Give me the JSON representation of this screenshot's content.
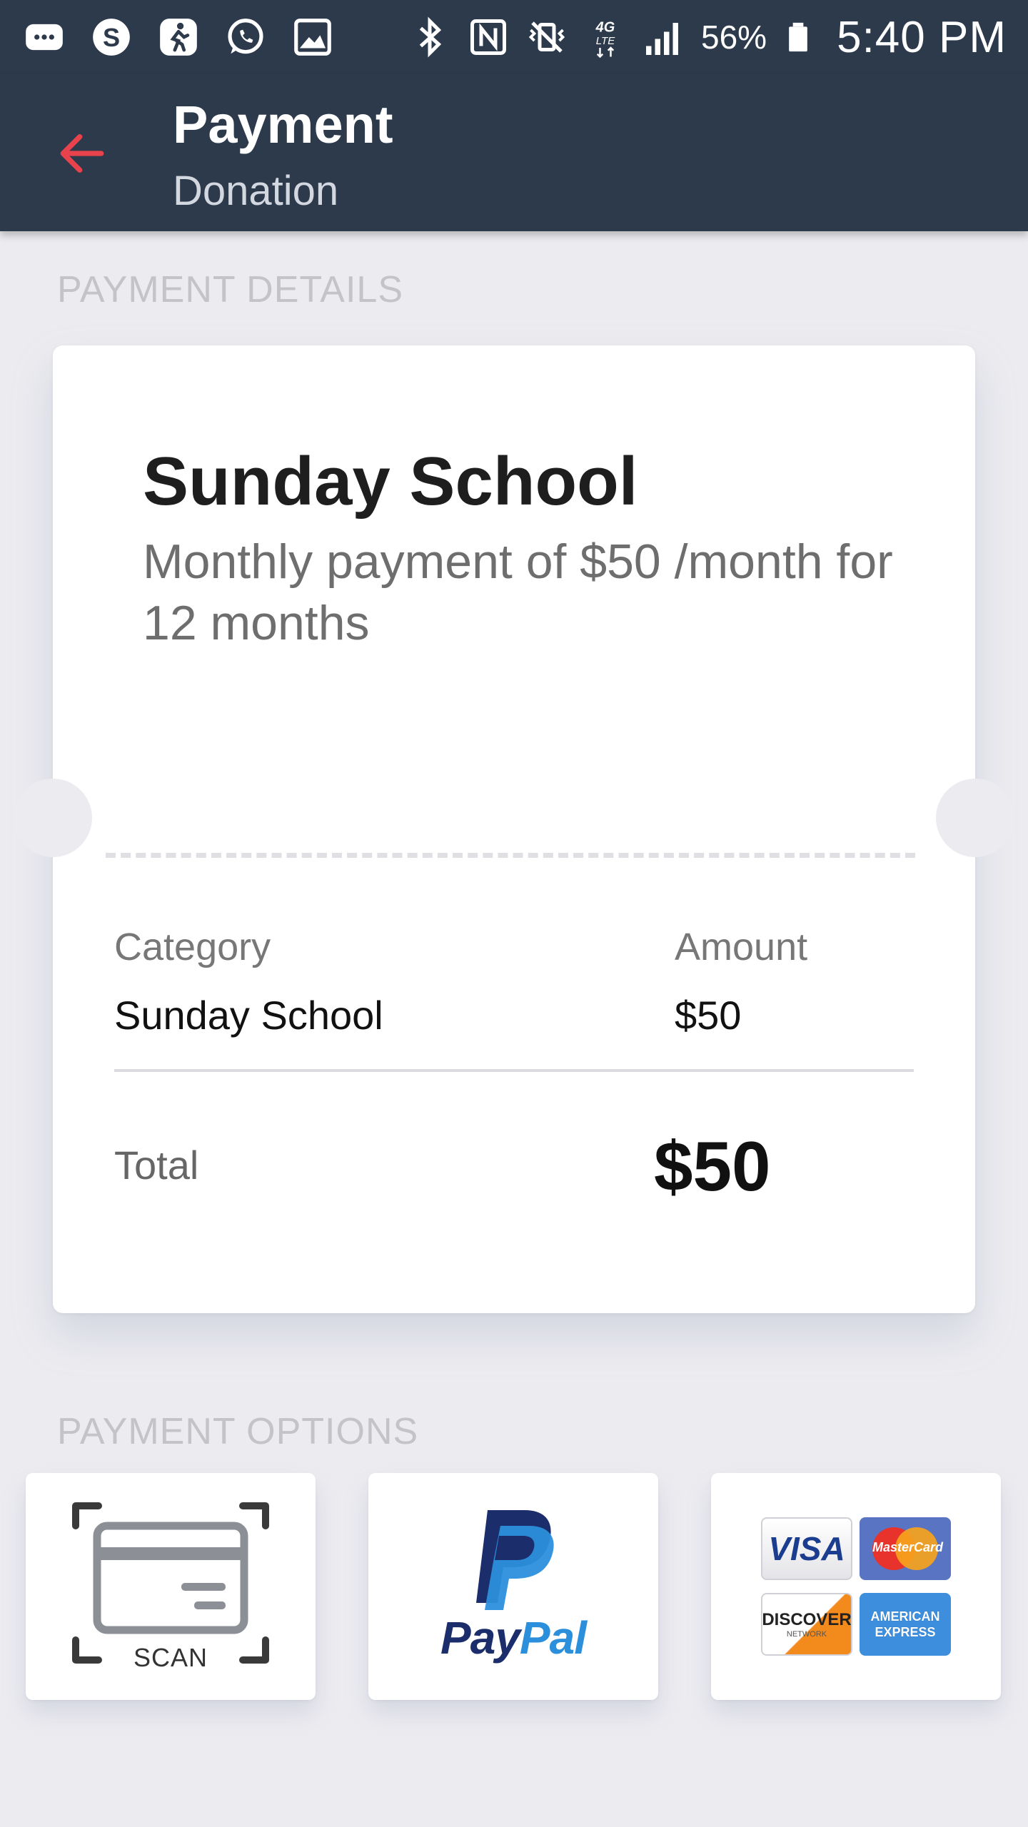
{
  "status_bar": {
    "left_icons": [
      "messages-icon",
      "skype-icon",
      "fitness-app-icon",
      "whatsapp-icon",
      "gallery-icon"
    ],
    "right_icons": [
      "bluetooth-icon",
      "nfc-icon",
      "vibrate-mute-icon",
      "4g-lte-icon",
      "signal-icon",
      "battery-icon"
    ],
    "network_label": "4G LTE",
    "battery_percent": "56%",
    "time": "5:40 PM"
  },
  "appbar": {
    "title": "Payment",
    "subtitle": "Donation",
    "back_icon": "arrow-left-icon",
    "accent_color": "#e8424d",
    "background_color": "#2d3a4c"
  },
  "payment_details": {
    "section_label": "PAYMENT DETAILS",
    "title": "Sunday School",
    "description": "Monthly payment of $50 /month for 12 months",
    "category_header": "Category",
    "amount_header": "Amount",
    "category_value": "Sunday School",
    "amount_value": "$50",
    "total_label": "Total",
    "total_value": "$50"
  },
  "payment_options": {
    "section_label": "PAYMENT OPTIONS",
    "items": [
      {
        "name": "scan",
        "icon": "card-scan-icon",
        "label": "SCAN"
      },
      {
        "name": "paypal",
        "icon": "paypal-icon",
        "label_part1": "Pay",
        "label_part2": "Pal"
      },
      {
        "name": "cards",
        "icon": "credit-cards-icon",
        "logos": [
          "VISA",
          "MasterCard",
          "DISCOVER",
          "AMERICAN EXPRESS"
        ],
        "discover_sub": "NETWORK"
      }
    ]
  }
}
